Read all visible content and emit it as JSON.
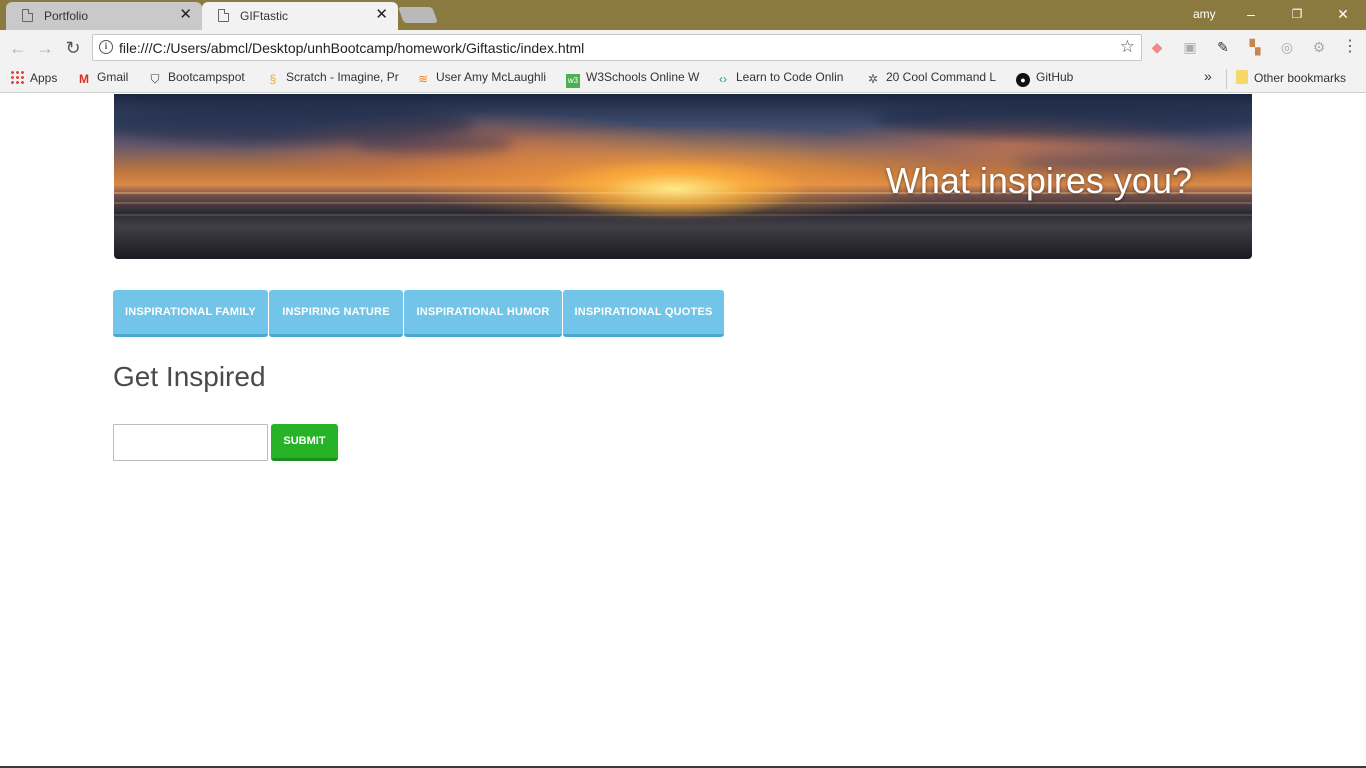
{
  "browser": {
    "tabs": [
      {
        "label": "Portfolio",
        "active": false
      },
      {
        "label": "GIFtastic",
        "active": true
      }
    ],
    "user": "amy",
    "window_controls": {
      "minimize": "–",
      "restore": "❐",
      "close": "✕"
    },
    "url": "file:///C:/Users/abmcl/Desktop/unhBootcamp/homework/Giftastic/index.html",
    "bookmarks": [
      {
        "label": "Apps",
        "icon": "apps-grid-icon"
      },
      {
        "label": "Gmail",
        "icon": "gmail-icon"
      },
      {
        "label": "Bootcampspot",
        "icon": "bootcampspot-icon"
      },
      {
        "label": "Scratch - Imagine, Pr",
        "icon": "scratch-icon"
      },
      {
        "label": "User Amy McLaughli",
        "icon": "stackoverflow-icon"
      },
      {
        "label": "W3Schools Online W",
        "icon": "w3schools-icon"
      },
      {
        "label": "Learn to Code Onlin",
        "icon": "code-icon"
      },
      {
        "label": "20 Cool Command L",
        "icon": "command-icon"
      },
      {
        "label": "GitHub",
        "icon": "github-icon"
      }
    ],
    "overflow_label": "»",
    "other_bookmarks": "Other bookmarks"
  },
  "page": {
    "banner_title": "What inspires you?",
    "topic_buttons": [
      {
        "label": "Inspirational Family"
      },
      {
        "label": "Inspiring Nature"
      },
      {
        "label": "Inspirational Humor"
      },
      {
        "label": "Inspirational Quotes"
      }
    ],
    "heading": "Get Inspired",
    "search": {
      "value": "",
      "placeholder": ""
    },
    "submit_label": "Submit"
  },
  "colors": {
    "topic_button": "#72c4e8",
    "submit_button": "#27b327",
    "titlebar": "#8a7a3f"
  }
}
